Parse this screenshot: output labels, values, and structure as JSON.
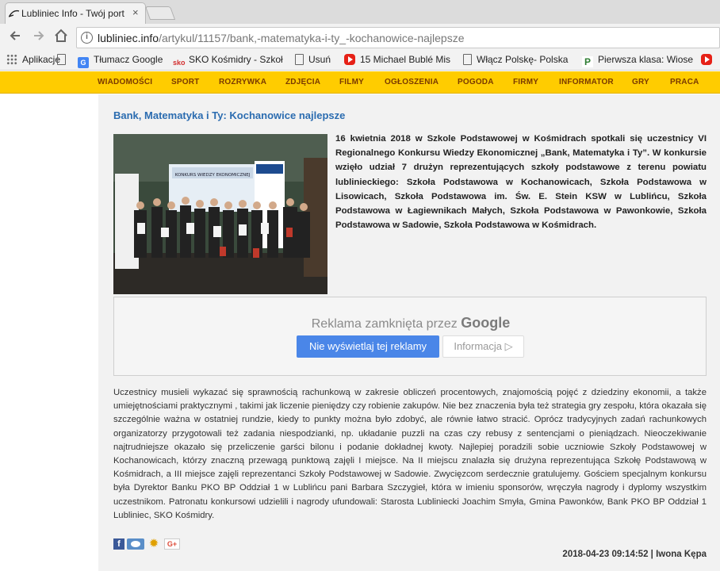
{
  "browser": {
    "tab_title": "Lubliniec Info - Twój port",
    "tab_close": "×",
    "url_domain": "lubliniec.info",
    "url_path": "/artykul/11157/bank,-matematyka-i-ty_-kochanowice-najlepsze",
    "bookmarks": [
      {
        "label": "Aplikacje",
        "icon": "apps-icon"
      },
      {
        "label": "",
        "icon": "doc-icon"
      },
      {
        "label": "Tłumacz Google",
        "icon": "google-translate-icon"
      },
      {
        "label": "SKO Kośmidry - Szkoł",
        "icon": "sko-icon"
      },
      {
        "label": "Usuń",
        "icon": "doc-icon"
      },
      {
        "label": "15 Michael Bublé Mis",
        "icon": "youtube-icon"
      },
      {
        "label": "Włącz Polskę- Polska",
        "icon": "doc-icon"
      },
      {
        "label": "Pierwsza klasa: Wiose",
        "icon": "p-icon"
      },
      {
        "label": "",
        "icon": "youtube-icon"
      }
    ]
  },
  "sitenav": {
    "items": [
      "WIADOMOŚCI",
      "SPORT",
      "ROZRYWKA",
      "ZDJĘCIA",
      "FILMY",
      "OGŁOSZENIA",
      "POGODA",
      "FIRMY",
      "INFORMATOR",
      "GRY",
      "PRACA"
    ]
  },
  "article": {
    "title": "Bank, Matematyka i Ty: Kochanowice najlepsze",
    "photo_banner": "KONKURS WIEDZY EKONOMICZNEJ",
    "lead": "16 kwietnia 2018 w Szkole Podstawowej w Kośmidrach spotkali się uczestnicy VI Regionalnego Konkursu Wiedzy Ekonomicznej „Bank, Matematyka i Ty”. W konkursie wzięło udział 7 drużyn reprezentujących szkoły podstawowe z terenu powiatu lublinieckiego: Szkoła Podstawowa w Kochanowicach, Szkoła Podstawowa w Lisowicach, Szkoła Podstawowa im. Św. E. Stein KSW w Lublińcu, Szkoła Podstawowa w Łagiewnikach Małych, Szkoła Podstawowa w Pawonkowie, Szkoła Podstawowa w Sadowie, Szkoła Podstawowa w Kośmidrach.",
    "body": "Uczestnicy musieli wykazać się sprawnością rachunkową w zakresie obliczeń procentowych, znajomością pojęć z dziedziny ekonomii, a także umiejętnościami praktycznymi , takimi jak liczenie pieniędzy czy robienie zakupów. Nie bez znaczenia była też strategia gry zespołu, która okazała się szczególnie ważna w ostatniej rundzie, kiedy to punkty można było zdobyć, ale równie łatwo stracić. Oprócz tradycyjnych zadań rachunkowych organizatorzy przygotowali też zadania niespodzianki, np. układanie puzzli na czas czy rebusy z sentencjami o pieniądzach. Nieoczekiwanie najtrudniejsze okazało się przeliczenie garści bilonu i podanie dokładnej kwoty. Najlepiej poradzili sobie uczniowie Szkoły Podstawowej w Kochanowicach, którzy znaczną przewagą punktową zajęli I miejsce. Na II miejscu znalazła się drużyna reprezentująca Szkołę Podstawową w Kośmidrach, a III miejsce zajęli reprezentanci Szkoły Podstawowej w Sadowie. Zwycięzcom serdecznie gratulujemy. Gościem specjalnym konkursu była Dyrektor Banku PKO BP Oddział 1 w Lublińcu pani Barbara Szczygieł, która w imieniu sponsorów, wręczyła nagrody i dyplomy wszystkim uczestnikom. Patronatu konkursowi udzielili i nagrody ufundowali: Starosta Lubliniecki Joachim Smyła, Gmina Pawonków, Bank PKO BP Oddział 1 Lubliniec, SKO Kośmidry.",
    "meta": "2018-04-23 09:14:52 | Iwona Kępa"
  },
  "ad": {
    "closed_text": "Reklama zamknięta przez",
    "brand": "Google",
    "stop_button": "Nie wyświetlaj tej reklamy",
    "info_button": "Informacja ▷"
  },
  "social": {
    "facebook": "f",
    "gplus": "G+"
  }
}
